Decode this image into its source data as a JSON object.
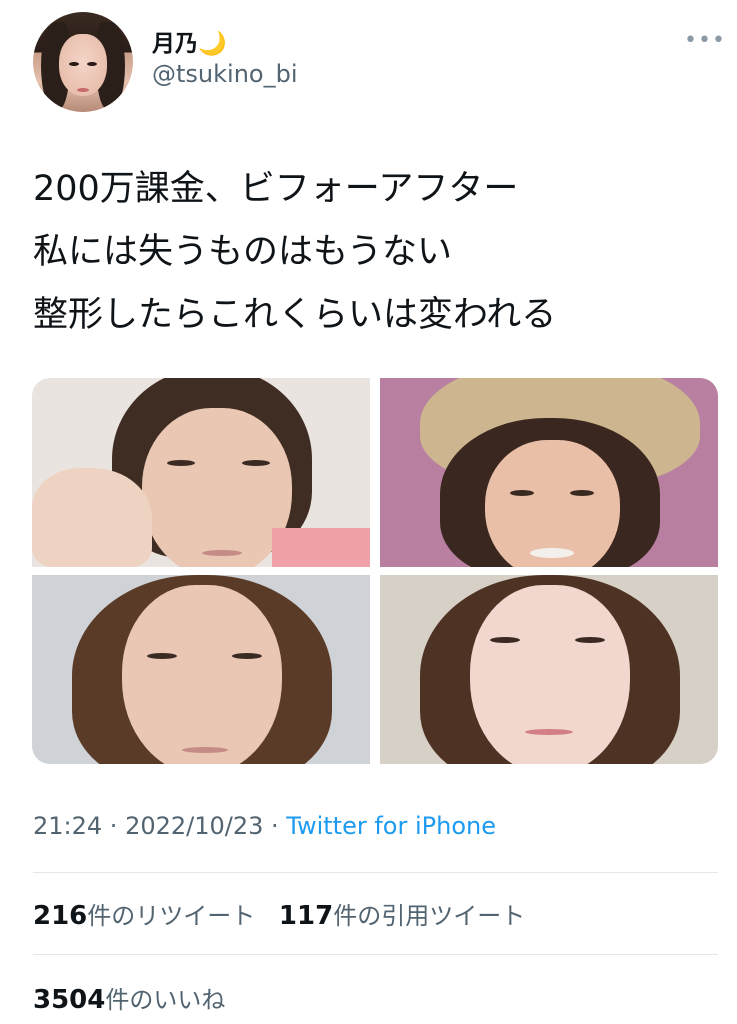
{
  "user": {
    "display_name": "月乃🌙",
    "handle": "@tsukino_bi"
  },
  "more_icon": "more-dots-icon",
  "tweet": {
    "lines": [
      "200万課金、ビフォーアフター",
      "私には失うものはもうない",
      "整形したらこれくらいは変われる"
    ]
  },
  "timestamp": {
    "time": "21:24",
    "separator": " · ",
    "date": "2022/10/23",
    "source": "Twitter for iPhone"
  },
  "stats": {
    "retweets_count": "216",
    "retweets_label": "件のリツイート",
    "quotes_count": "117",
    "quotes_label": "件の引用ツイート",
    "likes_count": "3504",
    "likes_label": "件のいいね"
  }
}
